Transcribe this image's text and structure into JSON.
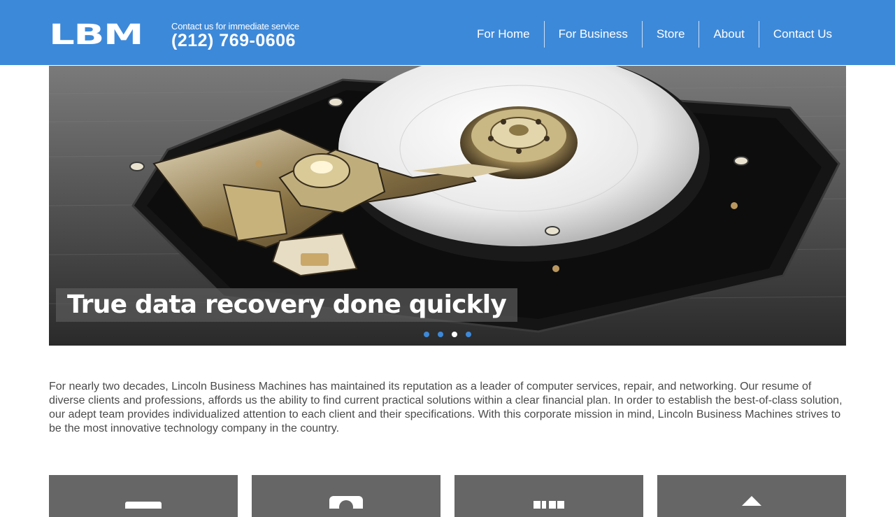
{
  "header": {
    "logo_text": "LBM",
    "phone_tagline": "Contact us for immediate service",
    "phone_number": "(212) 769-0606",
    "background": "#3d89d9"
  },
  "nav": {
    "items": [
      {
        "label": "For Home"
      },
      {
        "label": "For Business"
      },
      {
        "label": "Store"
      },
      {
        "label": "About"
      },
      {
        "label": "Contact Us"
      }
    ]
  },
  "hero": {
    "caption": "True data recovery done quickly",
    "image": "hard-drive-photo",
    "slides": 4,
    "active_slide": 3
  },
  "intro": {
    "text": "For nearly two decades, Lincoln Business Machines has maintained its reputation as a leader of computer services, repair, and networking. Our resume of diverse clients and professions, affords us the ability to find current practical solutions within a clear financial plan. In order to establish the best-of-class solution, our adept team provides individualized attention to each client and their specifications. With this corporate mission in mind, Lincoln Business Machines strives to be the most innovative technology company in the country."
  },
  "cards": [
    {
      "icon": "monitor-icon"
    },
    {
      "icon": "user-icon"
    },
    {
      "icon": "grid-icon"
    },
    {
      "icon": "home-icon"
    }
  ],
  "colors": {
    "accent": "#3d89d9",
    "card": "#666666",
    "text": "#4a4a4a"
  }
}
